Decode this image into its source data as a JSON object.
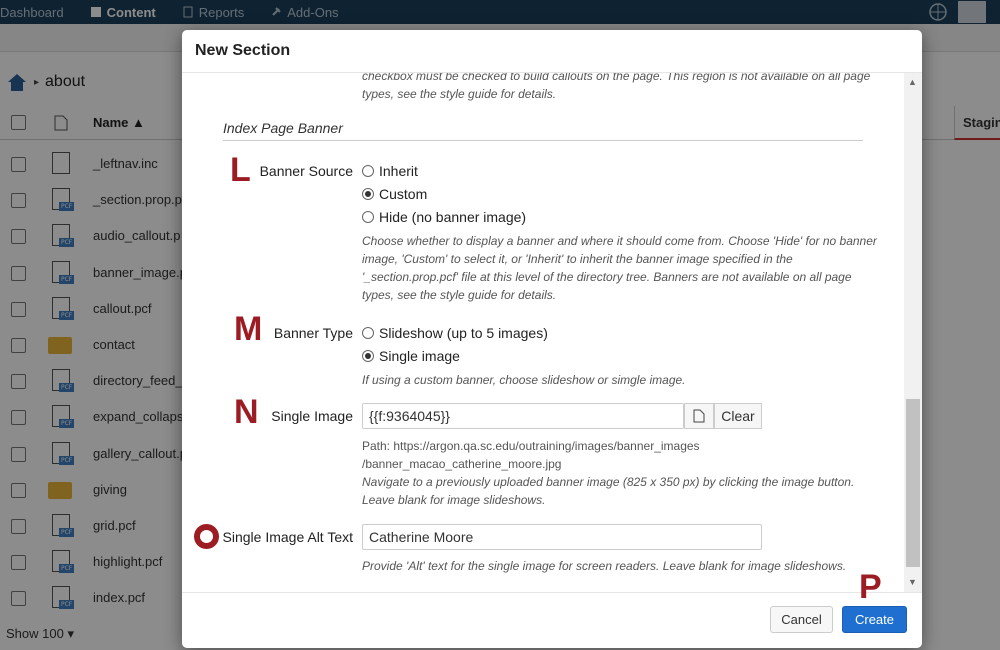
{
  "topnav": {
    "items": [
      {
        "label": "Dashboard",
        "icon": "dashboard-icon"
      },
      {
        "label": "Content",
        "icon": "content-icon"
      },
      {
        "label": "Reports",
        "icon": "reports-icon"
      },
      {
        "label": "Add-Ons",
        "icon": "add-ons-icon"
      }
    ],
    "active": "Content"
  },
  "breadcrumb": {
    "current": "about",
    "home_icon": "home-icon"
  },
  "file_table": {
    "name_header": "Name",
    "staging_header": "Stagin",
    "rows": [
      {
        "name": "_leftnav.inc",
        "type": "file"
      },
      {
        "name": "_section.prop.p",
        "type": "pcf"
      },
      {
        "name": "audio_callout.p",
        "type": "pcf"
      },
      {
        "name": "banner_image.p",
        "type": "pcf"
      },
      {
        "name": "callout.pcf",
        "type": "pcf"
      },
      {
        "name": "contact",
        "type": "folder"
      },
      {
        "name": "directory_feed_",
        "type": "pcf"
      },
      {
        "name": "expand_collaps",
        "type": "pcf"
      },
      {
        "name": "gallery_callout.p",
        "type": "pcf"
      },
      {
        "name": "giving",
        "type": "folder"
      },
      {
        "name": "grid.pcf",
        "type": "pcf"
      },
      {
        "name": "highlight.pcf",
        "type": "pcf"
      },
      {
        "name": "index.pcf",
        "type": "pcf"
      }
    ],
    "pcf_badge": "PCF",
    "show_label": "Show 100"
  },
  "modal": {
    "title": "New Section",
    "top_help": "checkbox must be checked to build callouts on the page. This region is not available on all page types, see the style guide for details.",
    "section_title": "Index Page Banner",
    "banner_source": {
      "label": "Banner Source",
      "options": [
        "Inherit",
        "Custom",
        "Hide (no banner image)"
      ],
      "selected": "Custom",
      "help": "Choose whether to display a banner and where it should come from. Choose 'Hide' for no banner image, 'Custom' to select it, or 'Inherit' to inherit the banner image specified in the '_section.prop.pcf' file at this level of the directory tree. Banners are not available on all page types, see the style guide for details."
    },
    "banner_type": {
      "label": "Banner Type",
      "options": [
        "Slideshow (up to 5 images)",
        "Single image"
      ],
      "selected": "Single image",
      "help": "If using a custom banner, choose slideshow or simgle image."
    },
    "single_image": {
      "label": "Single Image",
      "value": "{{f:9364045}}",
      "clear_label": "Clear",
      "path_line1": "Path: https://argon.qa.sc.edu/outraining/images/banner_images",
      "path_line2": "/banner_macao_catherine_moore.jpg",
      "help": "Navigate to a previously uploaded banner image (825 x 350 px) by clicking the image button. Leave blank for image slideshows."
    },
    "alt_text": {
      "label": "Single Image Alt Text",
      "value": "Catherine Moore",
      "help": "Provide 'Alt' text for the single image for screen readers. Leave blank for image slideshows."
    },
    "cancel_label": "Cancel",
    "create_label": "Create"
  },
  "annotations": {
    "L": "L",
    "M": "M",
    "N": "N",
    "P": "P"
  },
  "colors": {
    "accent": "#1e6fd0",
    "marker": "#9b1c23",
    "nav": "#1b3f5c"
  }
}
